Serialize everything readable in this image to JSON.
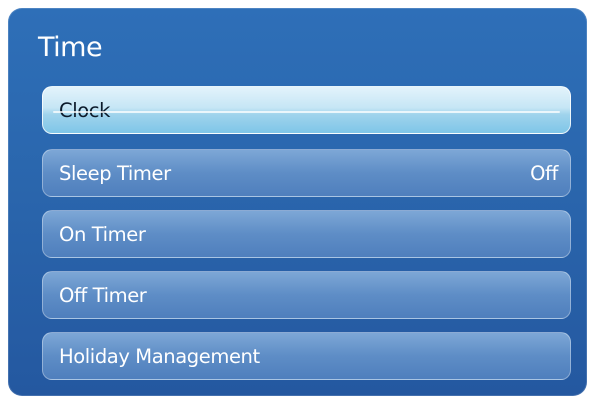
{
  "menu": {
    "title": "Time",
    "items": [
      {
        "label": "Clock",
        "value": "",
        "selected": true
      },
      {
        "label": "Sleep Timer",
        "value": "Off",
        "selected": false
      },
      {
        "label": "On Timer",
        "value": "",
        "selected": false
      },
      {
        "label": "Off Timer",
        "value": "",
        "selected": false
      },
      {
        "label": "Holiday Management",
        "value": "",
        "selected": false
      }
    ]
  },
  "colors": {
    "panel": "#2a66ad",
    "item": "#5e8dc6",
    "selected": "#c6e6f5",
    "text": "#ffffff",
    "selected_text": "#0b1a2a"
  }
}
